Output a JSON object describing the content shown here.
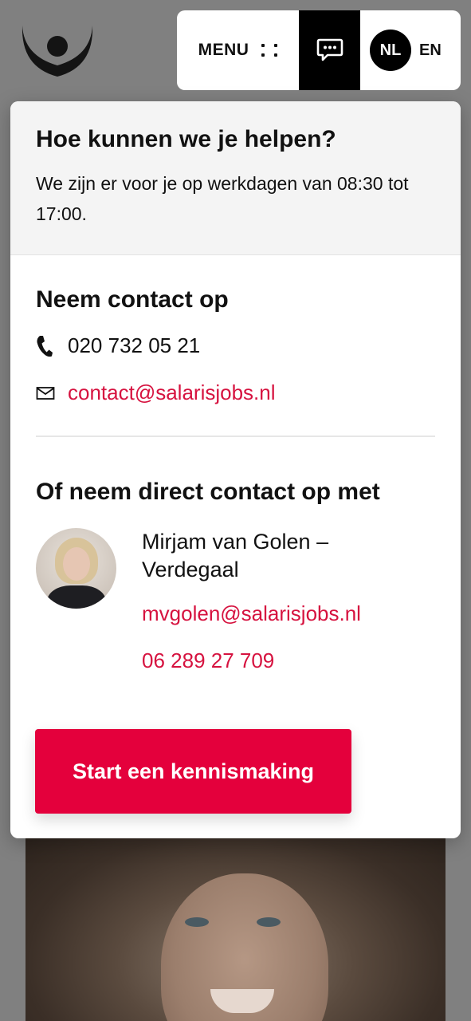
{
  "nav": {
    "menu_label": "MENU",
    "lang_active": "NL",
    "lang_other": "EN"
  },
  "contact": {
    "title": "Hoe kunnen we je helpen?",
    "subtitle": "We zijn er voor je op werkdagen van 08:30 tot 17:00.",
    "section_title": "Neem contact op",
    "phone": "020 732 05 21",
    "email": "contact@salarisjobs.nl",
    "direct_title": "Of neem direct contact op met",
    "person": {
      "name": "Mirjam van Golen – Verdegaal",
      "email": "mvgolen@salarisjobs.nl",
      "phone": "06 289 27 709"
    },
    "cta_label": "Start een kennismaking"
  },
  "icons": {
    "menu": "grid-dots-icon",
    "chat": "chat-bubble-icon",
    "phone": "phone-icon",
    "mail": "mail-icon"
  },
  "colors": {
    "accent": "#e4003c",
    "link": "#d6123f",
    "nav_active": "#000000"
  }
}
